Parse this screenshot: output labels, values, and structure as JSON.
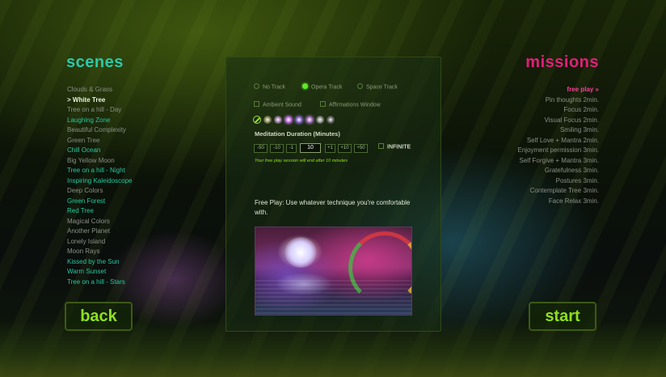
{
  "scenes": {
    "title": "scenes",
    "items": [
      {
        "label": "Clouds & Grass",
        "style": "normal"
      },
      {
        "label": "> White Tree",
        "style": "selected"
      },
      {
        "label": "Tree on a hill - Day",
        "style": "normal"
      },
      {
        "label": "Laughing Zone",
        "style": "teal"
      },
      {
        "label": "Beautiful Complexity",
        "style": "normal"
      },
      {
        "label": "Green Tree",
        "style": "normal"
      },
      {
        "label": "Chill Ocean",
        "style": "teal"
      },
      {
        "label": "Big Yellow Moon",
        "style": "normal"
      },
      {
        "label": "Tree on a hill - Night",
        "style": "teal"
      },
      {
        "label": "Inspiring Kaleidoscope",
        "style": "teal"
      },
      {
        "label": "Deep Colors",
        "style": "normal"
      },
      {
        "label": "Green Forest",
        "style": "teal"
      },
      {
        "label": "Red Tree",
        "style": "teal"
      },
      {
        "label": "Magical Colors",
        "style": "normal"
      },
      {
        "label": "Another Planet",
        "style": "normal"
      },
      {
        "label": "Lonely Island",
        "style": "normal"
      },
      {
        "label": "Moon Rays",
        "style": "normal"
      },
      {
        "label": "Kissed by the Sun",
        "style": "teal"
      },
      {
        "label": "Warm Sunset",
        "style": "teal"
      },
      {
        "label": "Tree on a hill - Stars",
        "style": "teal"
      }
    ]
  },
  "missions": {
    "title": "missions",
    "items": [
      {
        "label": "free play",
        "duration": "",
        "active": true
      },
      {
        "label": "Pin thoughts",
        "duration": "2min.",
        "active": false
      },
      {
        "label": "Focus",
        "duration": "2min.",
        "active": false
      },
      {
        "label": "Visual Focus",
        "duration": "2min.",
        "active": false
      },
      {
        "label": "Smiling",
        "duration": "3min.",
        "active": false
      },
      {
        "label": "Self Love + Mantra",
        "duration": "2min.",
        "active": false
      },
      {
        "label": "Enjoyment permission",
        "duration": "3min.",
        "active": false
      },
      {
        "label": "Self Forgive + Mantra",
        "duration": "3min.",
        "active": false
      },
      {
        "label": "Gratefulness",
        "duration": "3min.",
        "active": false
      },
      {
        "label": "Postures",
        "duration": "3min.",
        "active": false
      },
      {
        "label": "Contemplate Tree",
        "duration": "3min.",
        "active": false
      },
      {
        "label": "Face Relax",
        "duration": "3min.",
        "active": false
      }
    ]
  },
  "panel": {
    "tracks": [
      {
        "label": "No Track",
        "selected": false
      },
      {
        "label": "Opera Track",
        "selected": true
      },
      {
        "label": "Space Track",
        "selected": false
      }
    ],
    "ambient_sound_label": "Ambient Sound",
    "affirmations_label": "Affirmations Window",
    "ambient_sound_checked": false,
    "affirmations_checked": false,
    "sound_icons": [
      {
        "name": "none-icon",
        "color": "#9ee13a"
      },
      {
        "name": "sound-1-icon",
        "color": "#8a8a5a"
      },
      {
        "name": "sound-2-icon",
        "color": "#9a7aa0"
      },
      {
        "name": "sound-3-icon",
        "color": "#c070e0"
      },
      {
        "name": "sound-4-icon",
        "color": "#8a6ad0"
      },
      {
        "name": "sound-5-icon",
        "color": "#a870c0"
      },
      {
        "name": "sound-6-icon",
        "color": "#8a8a8a"
      },
      {
        "name": "sound-7-icon",
        "color": "#6a6a6a"
      }
    ],
    "duration_label": "Meditation Duration (Minutes)",
    "duration_buttons_minus": [
      "-50",
      "-10",
      "-1"
    ],
    "duration_value": "10",
    "duration_buttons_plus": [
      "+1",
      "+10",
      "+50"
    ],
    "infinite_label": "INFINITE",
    "infinite_checked": false,
    "session_note": "Your free play session will end after 10 minutes",
    "free_play_text": "Free Play: Use whatever technique you're comfortable with."
  },
  "buttons": {
    "back": "back",
    "start": "start"
  },
  "colors": {
    "scenes_title": "#2fc7a6",
    "missions_title": "#e0207a",
    "accent_green": "#8ee11c"
  }
}
